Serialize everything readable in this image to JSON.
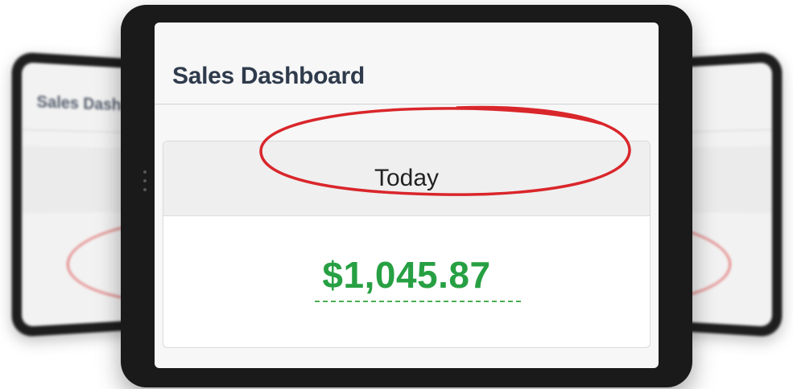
{
  "background_tablets": {
    "left_title": "Sales Dash"
  },
  "dashboard": {
    "title": "Sales Dashboard",
    "card": {
      "header": "Today",
      "amount": "$1,045.87"
    }
  },
  "colors": {
    "title": "#2f3b4c",
    "amount": "#27a043",
    "highlight": "#d9262b",
    "tablet_frame": "#1a1a1a"
  },
  "icons": {
    "annotation": "red-circle-highlight"
  }
}
